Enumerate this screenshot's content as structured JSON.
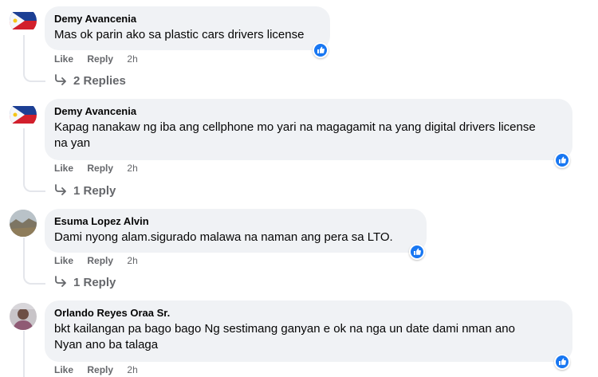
{
  "comments": [
    {
      "author": "Demy Avancenia",
      "text": "Mas ok parin ako sa plastic cars drivers license",
      "actions": {
        "like": "Like",
        "reply": "Reply",
        "time": "2h"
      },
      "replies_label": "2 Replies",
      "avatar": "philippine-flag"
    },
    {
      "author": "Demy Avancenia",
      "text": "Kapag nanakaw ng iba ang cellphone mo yari na magagamit na yang digital drivers license na yan",
      "actions": {
        "like": "Like",
        "reply": "Reply",
        "time": "2h"
      },
      "replies_label": "1 Reply",
      "avatar": "philippine-flag"
    },
    {
      "author": "Esuma Lopez Alvin",
      "text": "Dami nyong alam.sigurado malawa na naman ang pera sa LTO.",
      "actions": {
        "like": "Like",
        "reply": "Reply",
        "time": "2h"
      },
      "replies_label": "1 Reply",
      "avatar": "landscape-photo"
    },
    {
      "author": "Orlando Reyes Oraa Sr.",
      "text": "bkt kailangan pa bago bago Ng sestimang ganyan e ok na nga un date dami nman ano Nyan ano ba talaga",
      "actions": {
        "like": "Like",
        "reply": "Reply",
        "time": "2h"
      },
      "avatar": "person-photo"
    }
  ],
  "colors": {
    "bubble": "#f0f2f5",
    "meta_text": "#65676b",
    "like_blue": "#1877f2"
  }
}
